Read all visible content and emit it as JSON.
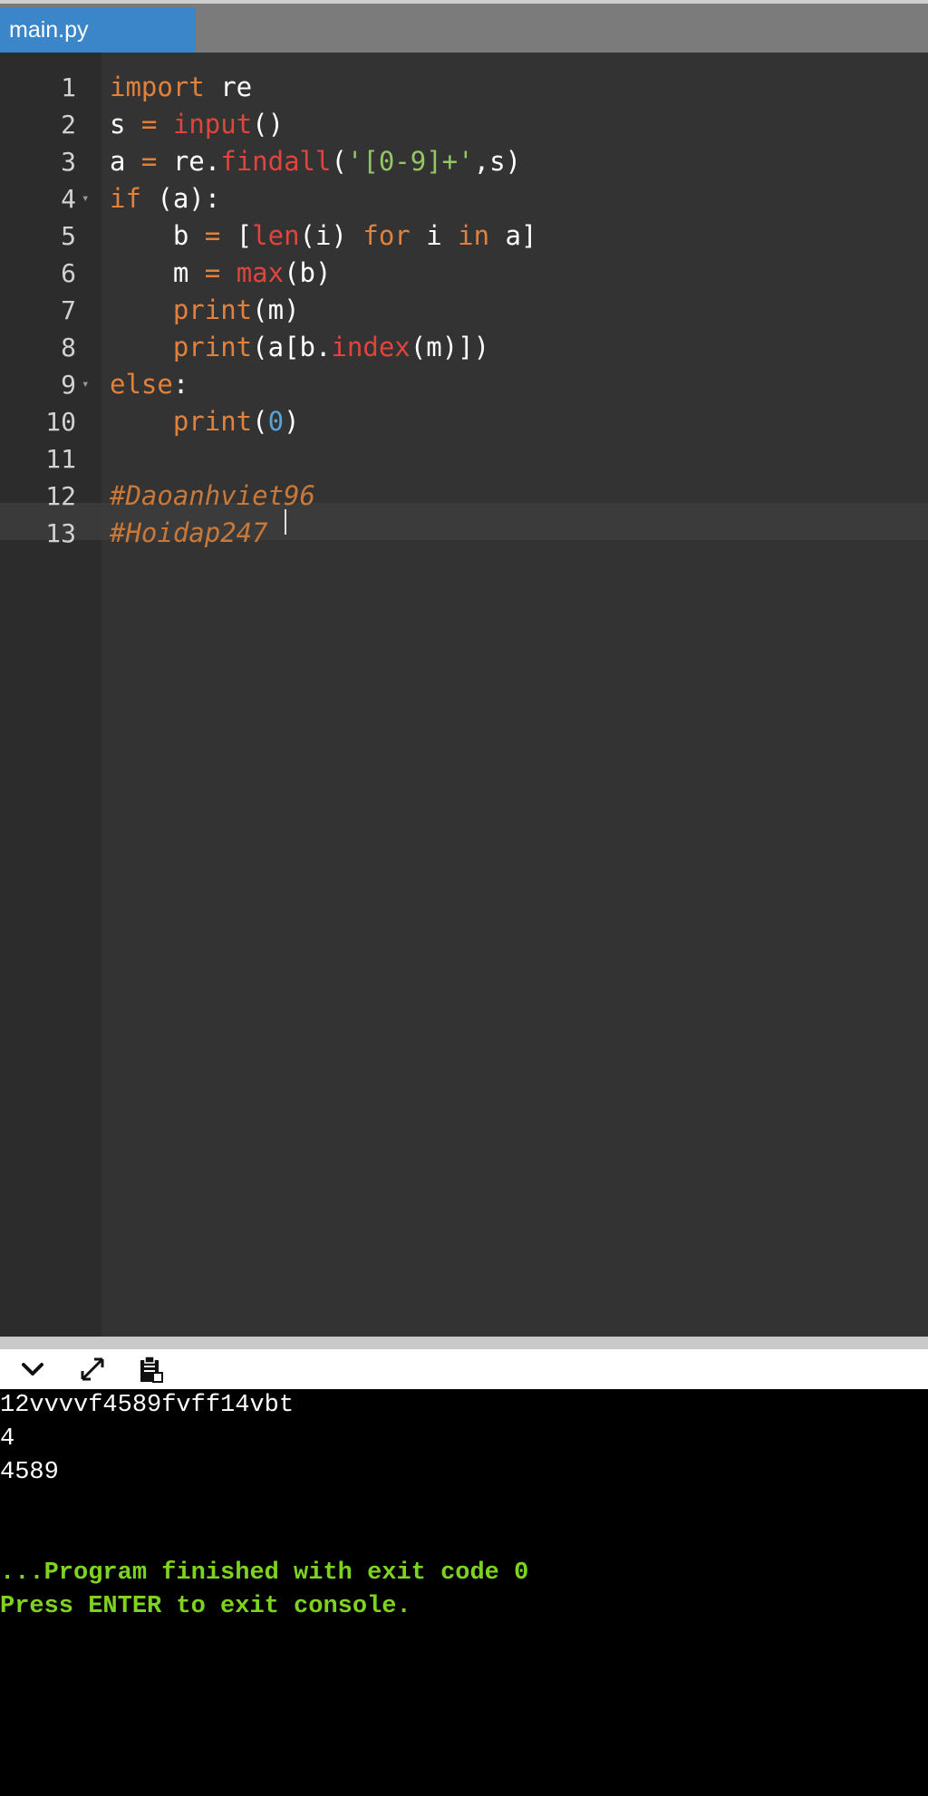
{
  "tab": {
    "label": "main.py"
  },
  "editor": {
    "line_numbers": [
      "1",
      "2",
      "3",
      "4",
      "5",
      "6",
      "7",
      "8",
      "9",
      "10",
      "11",
      "12",
      "13"
    ],
    "lines": [
      [
        {
          "t": "import",
          "c": "kw"
        },
        {
          "t": " re",
          "c": ""
        }
      ],
      [
        {
          "t": "s ",
          "c": ""
        },
        {
          "t": "=",
          "c": "kw"
        },
        {
          "t": " ",
          "c": ""
        },
        {
          "t": "input",
          "c": "fn"
        },
        {
          "t": "()",
          "c": ""
        }
      ],
      [
        {
          "t": "a ",
          "c": ""
        },
        {
          "t": "=",
          "c": "kw"
        },
        {
          "t": " re.",
          "c": ""
        },
        {
          "t": "findall",
          "c": "fn"
        },
        {
          "t": "(",
          "c": ""
        },
        {
          "t": "'[0-9]+'",
          "c": "str"
        },
        {
          "t": ",s)",
          "c": ""
        }
      ],
      [
        {
          "t": "if",
          "c": "kw"
        },
        {
          "t": " (a):",
          "c": ""
        }
      ],
      [
        {
          "t": "    b ",
          "c": ""
        },
        {
          "t": "=",
          "c": "kw"
        },
        {
          "t": " [",
          "c": ""
        },
        {
          "t": "len",
          "c": "fn"
        },
        {
          "t": "(i) ",
          "c": ""
        },
        {
          "t": "for",
          "c": "kw"
        },
        {
          "t": " i ",
          "c": ""
        },
        {
          "t": "in",
          "c": "kw"
        },
        {
          "t": " a]",
          "c": ""
        }
      ],
      [
        {
          "t": "    m ",
          "c": ""
        },
        {
          "t": "=",
          "c": "kw"
        },
        {
          "t": " ",
          "c": ""
        },
        {
          "t": "max",
          "c": "fn"
        },
        {
          "t": "(b)",
          "c": ""
        }
      ],
      [
        {
          "t": "    ",
          "c": ""
        },
        {
          "t": "print",
          "c": "kw"
        },
        {
          "t": "(m)",
          "c": ""
        }
      ],
      [
        {
          "t": "    ",
          "c": ""
        },
        {
          "t": "print",
          "c": "kw"
        },
        {
          "t": "(a[b.",
          "c": ""
        },
        {
          "t": "index",
          "c": "fn"
        },
        {
          "t": "(m)])",
          "c": ""
        }
      ],
      [
        {
          "t": "else",
          "c": "kw"
        },
        {
          "t": ":",
          "c": ""
        }
      ],
      [
        {
          "t": "    ",
          "c": ""
        },
        {
          "t": "print",
          "c": "kw"
        },
        {
          "t": "(",
          "c": ""
        },
        {
          "t": "0",
          "c": "num"
        },
        {
          "t": ")",
          "c": ""
        }
      ],
      [],
      [
        {
          "t": "#Daoanhviet96",
          "c": "cm"
        }
      ],
      [
        {
          "t": "#Hoidap247",
          "c": "cm"
        }
      ]
    ],
    "fold_markers": [
      "4",
      "9"
    ],
    "active_line": "13"
  },
  "console_toolbar": {
    "collapse_icon": "chevron-down-icon",
    "expand_icon": "expand-icon",
    "copy_icon": "clipboard-icon"
  },
  "console": {
    "output": [
      "12vvvvf4589fvff14vbt",
      "4",
      "4589"
    ],
    "exit_message": "...Program finished with exit code 0",
    "prompt_message": "Press ENTER to exit console."
  }
}
